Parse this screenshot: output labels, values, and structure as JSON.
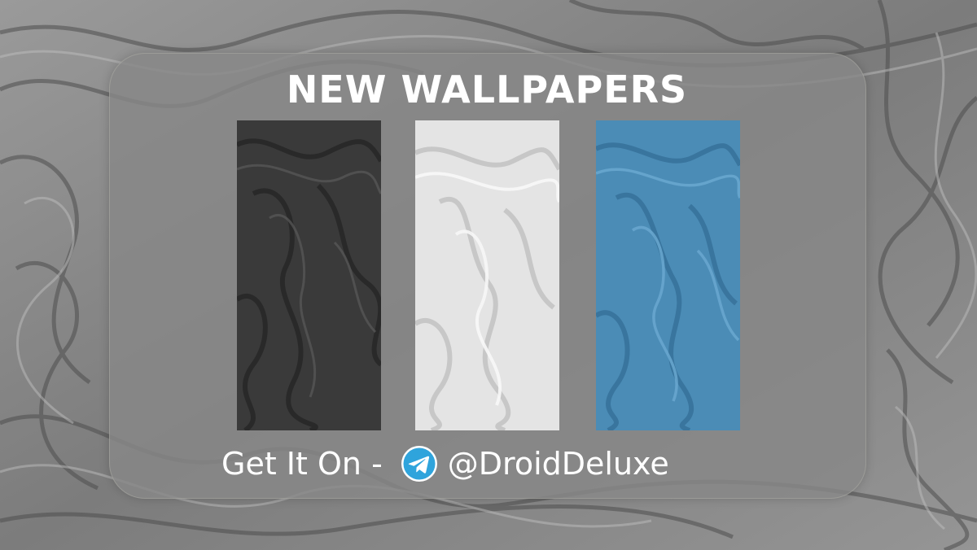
{
  "headline": "NEW WALLPAPERS",
  "footer": {
    "prefix": "Get It On -",
    "channel_icon": "telegram-icon",
    "handle": "@DroidDeluxe"
  },
  "wallpapers": [
    {
      "name": "dark",
      "color": "#3a3a3a"
    },
    {
      "name": "light",
      "color": "#e4e4e4"
    },
    {
      "name": "blue",
      "color": "#4b8cb6"
    }
  ],
  "colors": {
    "background": "#8a8a8a",
    "telegram": "#2fa4dc"
  }
}
